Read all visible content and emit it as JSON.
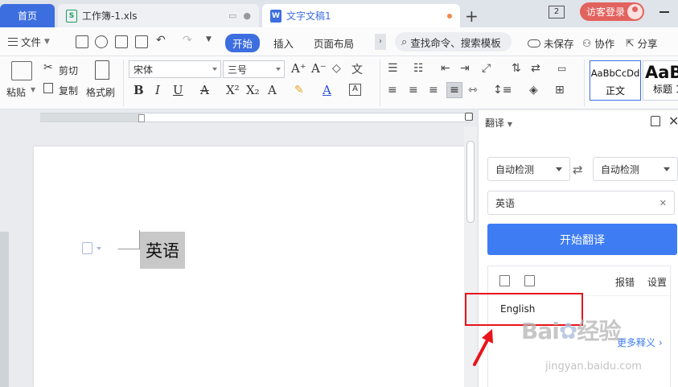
{
  "tabs": {
    "home": "首页",
    "xls": "工作簿-1.xls",
    "doc": "文字文稿1",
    "window_count": "2",
    "visitor_login": "访客登录"
  },
  "menu": {
    "file": "文件",
    "items": [
      "开始",
      "插入",
      "页面布局"
    ],
    "search_placeholder": "查找命令、搜索模板",
    "unsaved": "未保存",
    "collab": "协作",
    "share": "分享"
  },
  "ribbon": {
    "paste": "粘贴",
    "cut": "剪切",
    "copy": "复制",
    "format_painter": "格式刷",
    "font_name": "宋体",
    "font_size": "三号",
    "styles": [
      {
        "preview": "AaBbCcDd",
        "name": "正文"
      },
      {
        "preview": "AaB",
        "name": "标题 1"
      }
    ]
  },
  "document": {
    "text": "英语"
  },
  "translate_panel": {
    "title": "翻译",
    "source_lang": "自动检测",
    "target_lang": "自动检测",
    "input_text": "英语",
    "translate_button": "开始翻译",
    "report_error": "报错",
    "settings": "设置",
    "result": "English",
    "more_definitions": "更多释义"
  },
  "watermark": {
    "logo": "Baidu 经验",
    "url": "jingyan.baidu.com"
  },
  "colors": {
    "accent": "#3d6ee0",
    "translate_button": "#3d7cf3",
    "annotation": "#e8131b",
    "visitor": "#e2625d"
  }
}
